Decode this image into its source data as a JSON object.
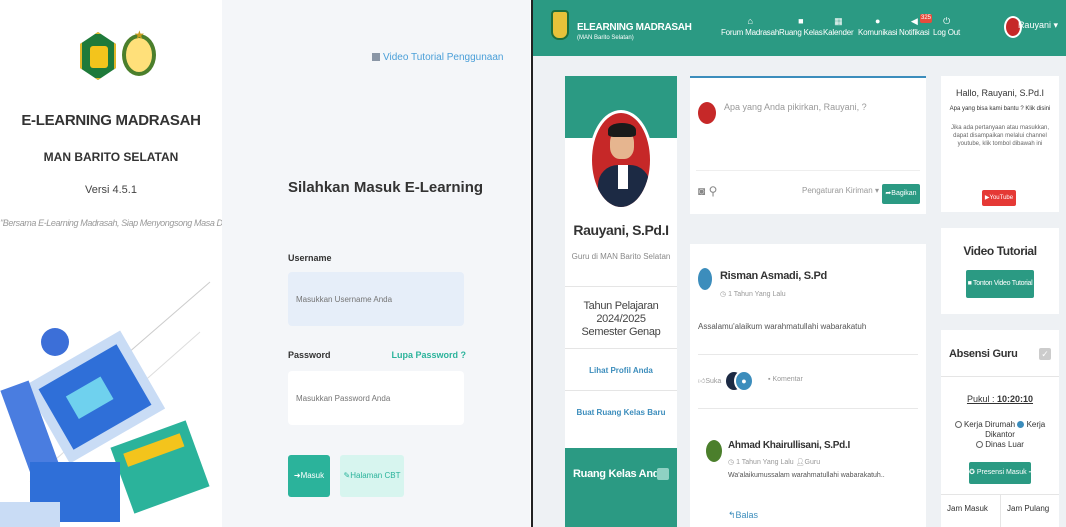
{
  "login": {
    "brand_title": "E-LEARNING MADRASAH",
    "school": "MAN BARITO SELATAN",
    "version": "Versi 4.5.1",
    "motto": "\"Bersama E-Learning Madrasah, Siap Menyongsong Masa Depan Gemilang\"",
    "video_link": "Video Tutorial Penggunaan",
    "form_title": "Silahkan Masuk E-Learning",
    "username_label": "Username",
    "username_placeholder": "Masukkan Username Anda",
    "password_label": "Password",
    "forgot_label": "Lupa Password ?",
    "password_placeholder": "Masukkan Password Anda",
    "login_button": "Masuk",
    "cbt_button": "Halaman CBT"
  },
  "topbar": {
    "app_name": "ELEARNING MADRASAH",
    "app_sub": "(MAN Barito Selatan)",
    "nav": [
      {
        "label": "Forum Madrasah",
        "icon": "home-icon"
      },
      {
        "label": "Ruang Kelas",
        "icon": "class-icon"
      },
      {
        "label": "Kalender",
        "icon": "calendar-icon"
      },
      {
        "label": "Komunikasi",
        "icon": "chat-icon"
      },
      {
        "label": "Notifikasi",
        "icon": "bell-icon"
      },
      {
        "label": "Log Out",
        "icon": "power-icon"
      }
    ],
    "notif_count": "325",
    "user": "Rauyani"
  },
  "profile": {
    "name": "Rauyani, S.Pd.I",
    "role": "Guru di MAN Barito Selatan",
    "year_line1": "Tahun Pelajaran 2024/2025",
    "year_line2": "Semester Genap",
    "link_profile": "Lihat Profil Anda",
    "link_create": "Buat Ruang Kelas Baru",
    "classes_title": "Ruang Kelas Anda"
  },
  "post_box": {
    "placeholder": "Apa yang Anda pikirkan, Rauyani, ?",
    "privacy": "Pengaturan Kiriman",
    "share": "Bagikan"
  },
  "feed": {
    "author": "Risman Asmadi, S.Pd",
    "time": "1 Tahun Yang Lalu",
    "text": "Assalamu'alaikum warahmatullahi wabarakatuh",
    "like": "Suka",
    "comment": "Komentar",
    "reply_author": "Ahmad Khairullisani, S.Pd.I",
    "reply_time": "1 Tahun Yang Lalu",
    "reply_role": "Guru",
    "reply_text": "Wa'alaikumussalam warahmatullahi wabarakatuh..",
    "reply_button": "Balas"
  },
  "help": {
    "greeting": "Hallo, Rauyani, S.Pd.I",
    "question": "Apa yang bisa kami bantu ? Klik disini",
    "desc": "Jika ada pertanyaan atau masukkan, dapat disampaikan melalui channel youtube, klik tombol dibawah ini",
    "youtube": "YouTube"
  },
  "video": {
    "title": "Video Tutorial",
    "button": "Tonton Video Tutorial"
  },
  "absensi": {
    "title": "Absensi Guru",
    "pukul_label": "Pukul : ",
    "pukul_time": "10:20:10",
    "opt1": "Kerja Dirumah",
    "opt2": "Kerja Dikantor",
    "opt3": "Dinas Luar",
    "button": "Presensi Masuk",
    "col1": "Jam Masuk",
    "col2": "Jam Pulang"
  },
  "colors": {
    "primary": "#2b9a83",
    "link": "#3c8dbc"
  }
}
